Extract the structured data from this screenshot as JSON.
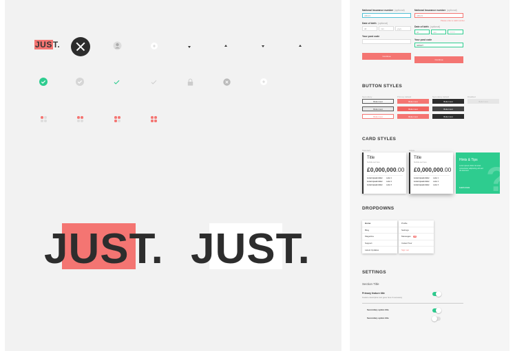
{
  "logo": {
    "highlight": "JUS",
    "rest": "T."
  },
  "icons": {
    "row1": [
      "close-circle-icon",
      "user-icon",
      "plus-icon",
      "caret-down-icon",
      "caret-up-icon",
      "caret-down-icon",
      "caret-up-icon"
    ],
    "row2": [
      "check-circle-icon",
      "check-circle-disabled-icon",
      "check-icon",
      "check-light-icon",
      "lock-icon",
      "clear-icon",
      "plus-icon"
    ],
    "row3": [
      "dots-icon",
      "dots-icon",
      "dots-icon",
      "dots-icon"
    ]
  },
  "colors": {
    "brand": "#f47572",
    "dark": "#2d2d2d",
    "green": "#2ecc8f",
    "teal": "#4ec0d6"
  },
  "form": {
    "ni_label": "National Insurance number",
    "optional": "(optional)",
    "ni_value": "AB123",
    "dob_label": "Date of birth",
    "dob_day": "dd",
    "dob_month": "mm",
    "dob_year": "yyyy",
    "dob_day_right": "dd",
    "dob_month_right": "mm",
    "dob_year_right": "YYYY",
    "error_text": "Please enter a valid number",
    "postcode_label": "Your post code",
    "postcode_value": "SW12T",
    "submit": "Continue"
  },
  "button_styles": {
    "title": "BUTTON STYLES",
    "col_labels": [
      "Secondary",
      "Primary default",
      "Secondary default",
      "Disabled"
    ],
    "label": "Button text"
  },
  "card_styles": {
    "title": "CARD STYLES",
    "label_1": "Standard",
    "label_2": "Active",
    "card_title": "Title",
    "card_sub": "Subtitle text here",
    "amount": "£0,000,000",
    "amount_dec": ".00",
    "rows": [
      [
        "Lorem ipsum dolor",
        "Label 1"
      ],
      [
        "Lorem ipsum dolor",
        "Label 2"
      ],
      [
        "Lorem ipsum dolor",
        "Label 3"
      ]
    ],
    "tip_title": "Hints & Tips",
    "tip_body": "Lorem ipsum dolor sit amet consectetur adipiscing elit sed do eiusmod",
    "tip_link": "Learn more",
    "tip_mark": "?"
  },
  "dropdowns": {
    "title": "DROPDOWNS",
    "menu1": [
      "Home",
      "Blog",
      "Magazine",
      "Support",
      "Latest Updates"
    ],
    "menu2": [
      "Profile",
      "Settings",
      "Messages",
      "Invited Tour",
      "Sign out"
    ],
    "badge": "12"
  },
  "settings": {
    "title": "SETTINGS",
    "section": "Section Title",
    "primary": "Primary feature title",
    "primary_desc": "Feature description text goes here if necessary",
    "secondary_1": "Secondary option title",
    "secondary_2": "Secondary option title"
  }
}
